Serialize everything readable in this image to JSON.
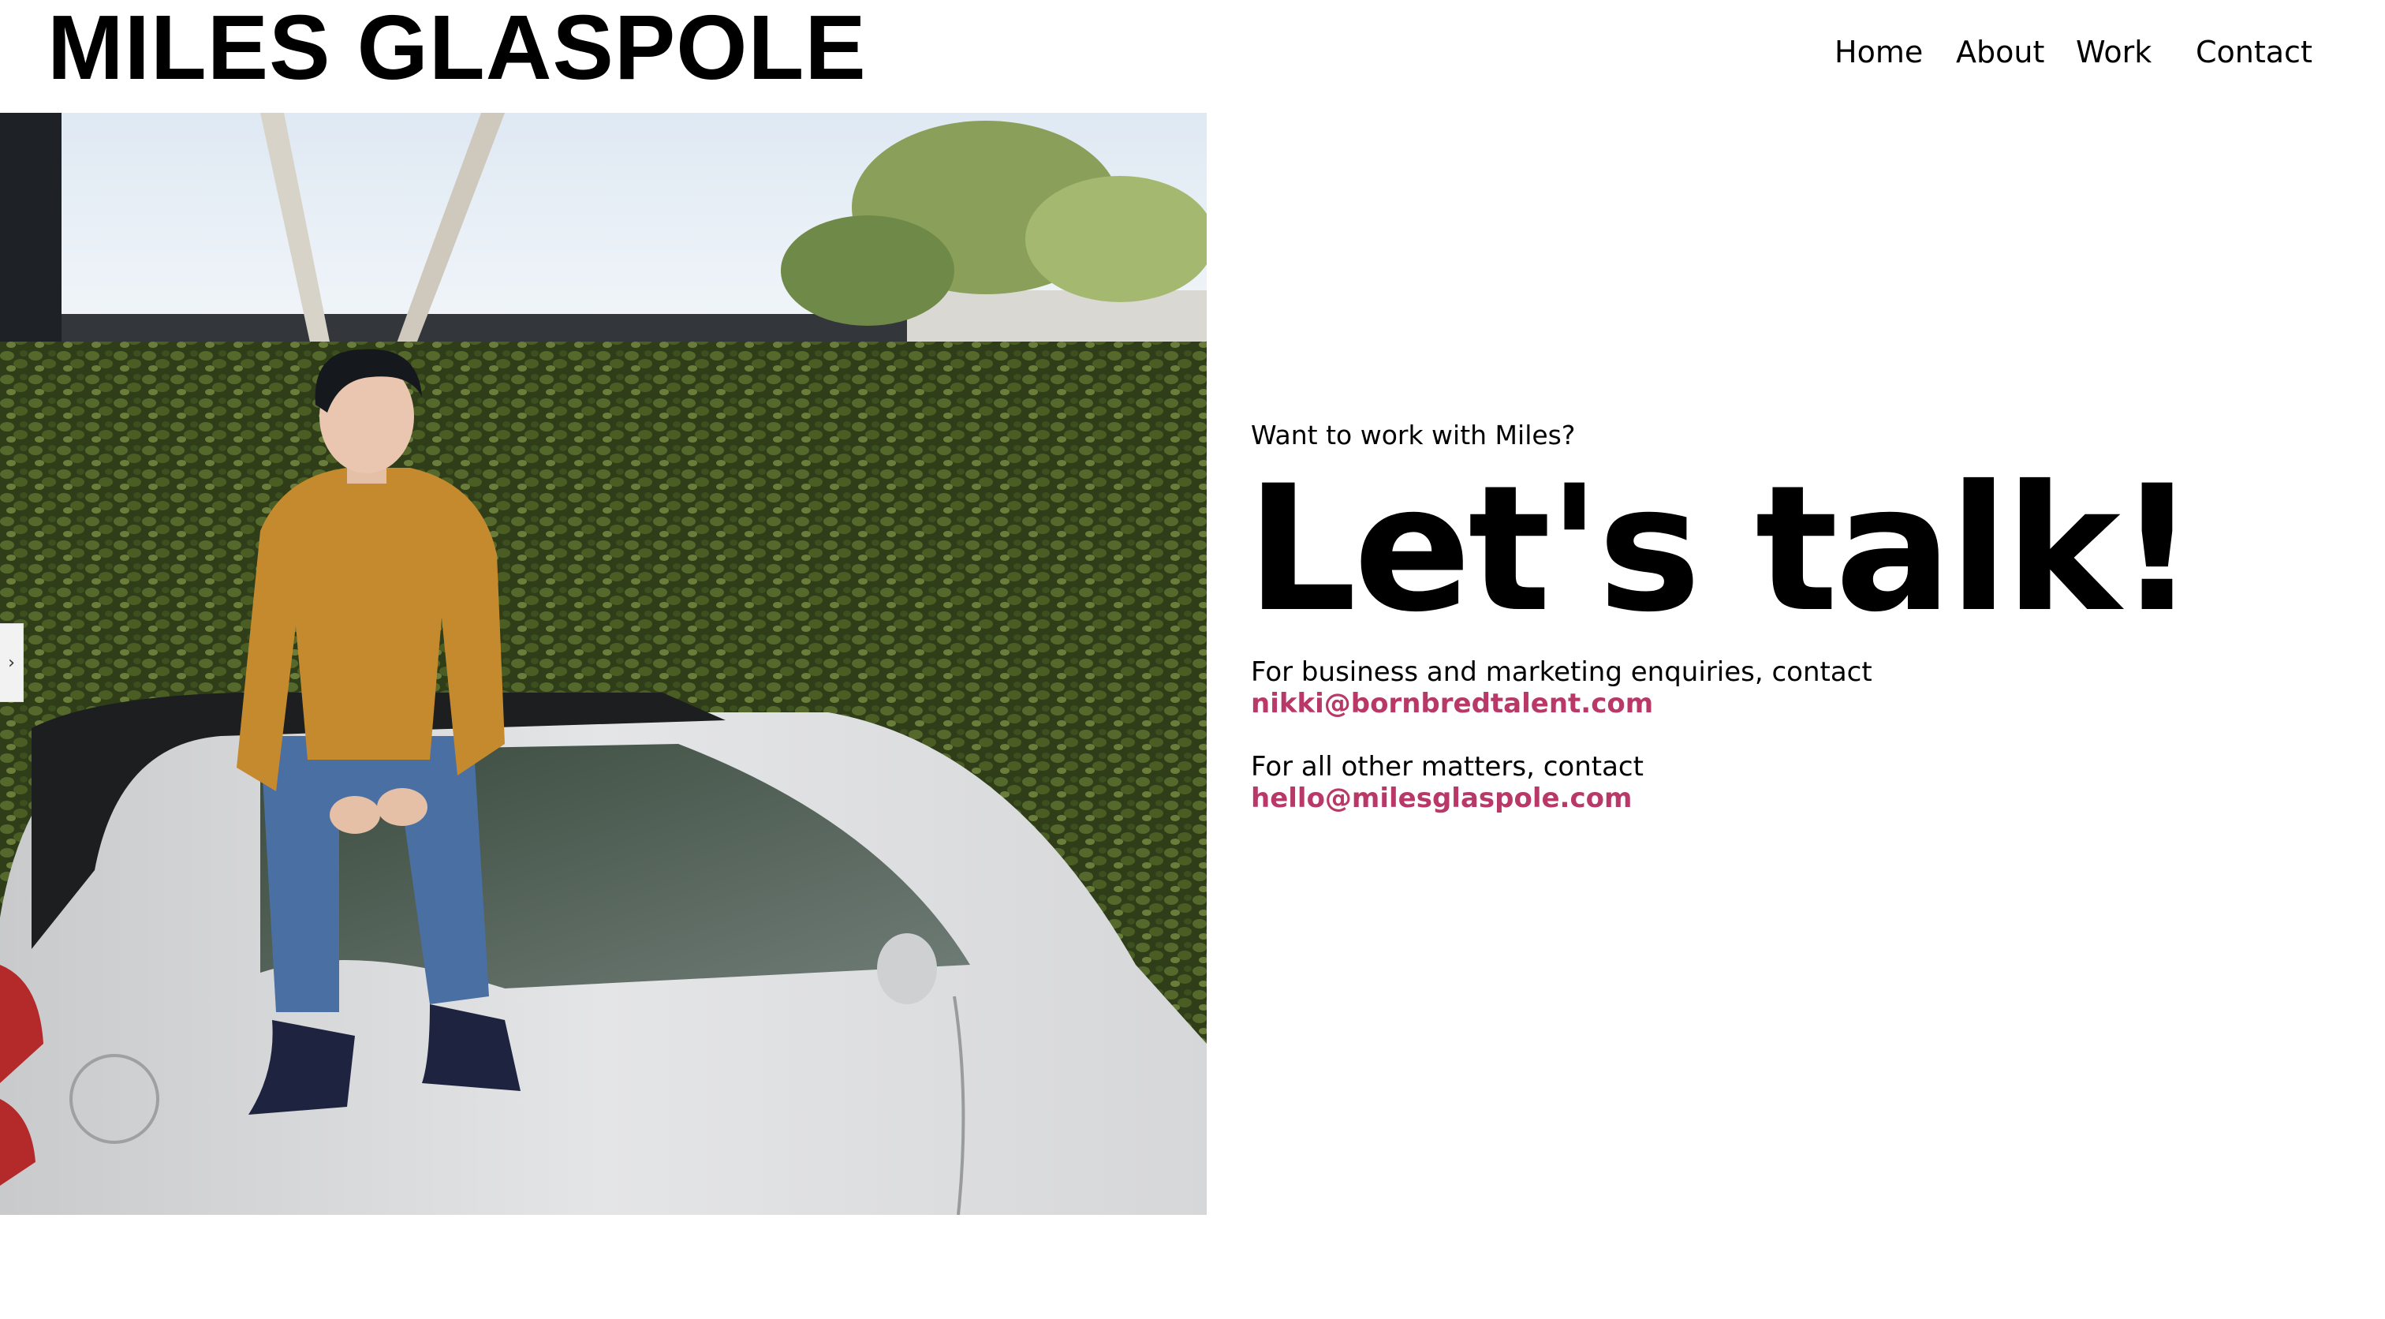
{
  "header": {
    "site_title": "MILES GLASPOLE",
    "nav": {
      "home": "Home",
      "about": "About",
      "work": "Work",
      "contact": "Contact"
    }
  },
  "photo": {
    "description_icon": "photo-of-person-sitting-on-car"
  },
  "side_tab": {
    "icon": "chevron-right-icon",
    "glyph": "›"
  },
  "contact": {
    "eyebrow": "Want to work with Miles?",
    "headline": "Let's talk!",
    "business_line": "For business and marketing enquiries, contact",
    "business_email": "nikki@bornbredtalent.com",
    "other_line": "For all other matters, contact",
    "other_email": "hello@milesglaspole.com"
  },
  "colors": {
    "background": "#ffffff",
    "text": "#000000",
    "link_accent": "#b83868"
  }
}
